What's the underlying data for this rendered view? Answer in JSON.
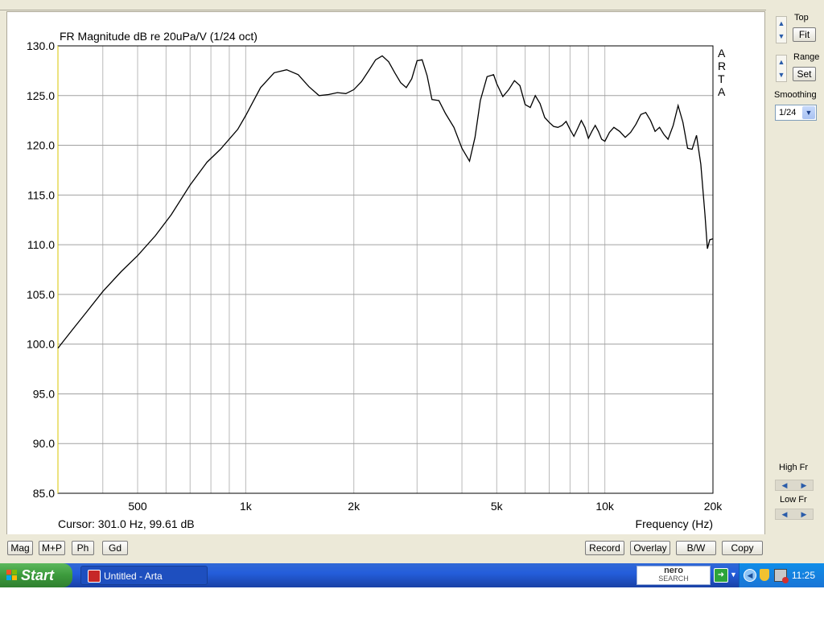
{
  "window": {
    "title": "Untitled - Arta"
  },
  "chart_data": {
    "type": "line",
    "title": "FR Magnitude dB re 20uPa/V (1/24 oct)",
    "xlabel": "Frequency (Hz)",
    "ylabel": "",
    "x_scale": "log",
    "xlim": [
      300,
      20000
    ],
    "ylim": [
      85,
      130
    ],
    "x_ticks": [
      500,
      1000,
      2000,
      5000,
      10000,
      20000
    ],
    "x_tick_labels": [
      "500",
      "1k",
      "2k",
      "5k",
      "10k",
      "20k"
    ],
    "y_ticks": [
      85,
      90,
      95,
      100,
      105,
      110,
      115,
      120,
      125,
      130
    ],
    "y_tick_labels": [
      "85.0",
      "90.0",
      "95.0",
      "100.0",
      "105.0",
      "110.0",
      "115.0",
      "120.0",
      "125.0",
      "130.0"
    ],
    "grid": true,
    "watermark": [
      "A",
      "R",
      "T",
      "A"
    ],
    "series": [
      {
        "x": [
          300,
          330,
          360,
          400,
          450,
          500,
          560,
          620,
          700,
          780,
          850,
          950,
          1000,
          1100,
          1200,
          1300,
          1400,
          1500,
          1600,
          1700,
          1800,
          1900,
          2000,
          2100,
          2200,
          2300,
          2400,
          2500,
          2600,
          2700,
          2800,
          2900,
          3000,
          3100,
          3200,
          3300,
          3450,
          3600,
          3800,
          4000,
          4200,
          4350,
          4500,
          4700,
          4900,
          5000,
          5200,
          5400,
          5600,
          5800,
          6000,
          6200,
          6400,
          6600,
          6800,
          7000,
          7200,
          7400,
          7600,
          7800,
          8000,
          8200,
          8400,
          8600,
          8800,
          9000,
          9200,
          9400,
          9600,
          9800,
          10000,
          10300,
          10600,
          11000,
          11400,
          11800,
          12200,
          12600,
          13000,
          13400,
          13800,
          14200,
          14600,
          15000,
          15500,
          16000,
          16500,
          17000,
          17500,
          18000,
          18500,
          19000,
          19300,
          19600,
          20000
        ],
        "y": [
          99.6,
          101.5,
          103.2,
          105.3,
          107.3,
          108.9,
          110.9,
          113.0,
          116.0,
          118.3,
          119.6,
          121.6,
          123.0,
          125.8,
          127.3,
          127.6,
          127.1,
          125.9,
          125.0,
          125.1,
          125.3,
          125.2,
          125.6,
          126.4,
          127.5,
          128.6,
          129.0,
          128.4,
          127.3,
          126.3,
          125.8,
          126.7,
          128.5,
          128.6,
          127.0,
          124.6,
          124.5,
          123.2,
          121.8,
          119.7,
          118.4,
          120.8,
          124.5,
          126.9,
          127.1,
          126.2,
          124.9,
          125.6,
          126.5,
          126.0,
          124.1,
          123.8,
          125.0,
          124.2,
          122.8,
          122.3,
          121.9,
          121.8,
          122.0,
          122.4,
          121.6,
          120.9,
          121.7,
          122.5,
          121.8,
          120.7,
          121.4,
          122.0,
          121.4,
          120.6,
          120.4,
          121.3,
          121.8,
          121.4,
          120.8,
          121.3,
          122.1,
          123.1,
          123.3,
          122.5,
          121.4,
          121.8,
          121.1,
          120.6,
          122.0,
          124.0,
          122.3,
          119.7,
          119.6,
          121.0,
          118.1,
          113.0,
          109.6,
          110.5,
          110.6
        ]
      }
    ]
  },
  "plot": {
    "cursor_text": "Cursor: 301.0 Hz, 99.61 dB"
  },
  "right_panel": {
    "top_label": "Top",
    "fit_button": "Fit",
    "range_label": "Range",
    "set_button": "Set",
    "smoothing_label": "Smoothing",
    "smoothing_value": "1/24",
    "high_fr_label": "High Fr",
    "low_fr_label": "Low Fr"
  },
  "bottom_buttons": {
    "mag": "Mag",
    "mp": "M+P",
    "ph": "Ph",
    "gd": "Gd",
    "record": "Record",
    "overlay": "Overlay",
    "bw": "B/W",
    "copy": "Copy"
  },
  "taskbar": {
    "start_label": "Start",
    "task_label": "Untitled - Arta",
    "nero_text": "nero",
    "nero_sub": "SEARCH",
    "clock": "11:25"
  }
}
